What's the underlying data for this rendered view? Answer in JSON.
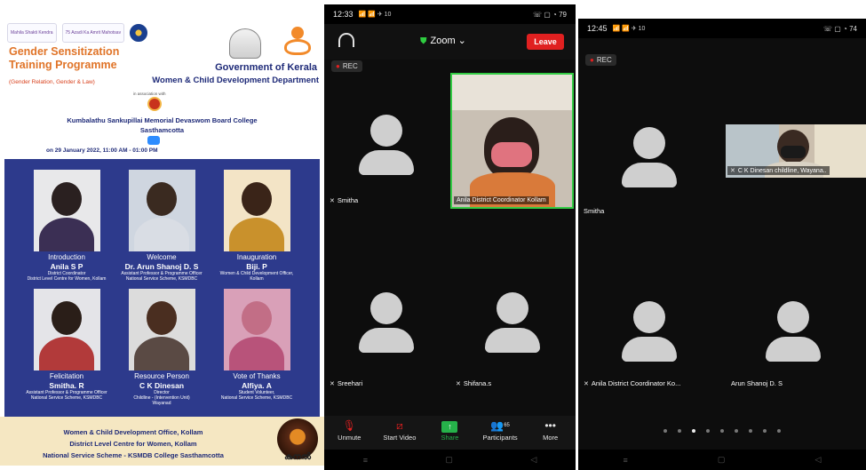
{
  "poster": {
    "logo1": "Mahila Shakti Kendra",
    "logo2": "75 Azadi Ka Amrit Mahotsav",
    "title_line1": "Gender Sensitization",
    "title_line2": "Training Programme",
    "subtitle": "(Gender Relation, Gender & Law)",
    "gov": "Government of Kerala",
    "dept": "Women & Child Development Department",
    "assoc": "in association with",
    "college_line1": "Kumbalathu Sankupillai Memorial Devaswom Board College",
    "college_line2": "Sasthamcotta",
    "date": "on 29 January 2022, 11:00 AM - 01:00 PM",
    "speakers": [
      {
        "role": "Introduction",
        "name": "Anila S P",
        "desc1": "District Coordinator",
        "desc2": "District Level Centre for Women, Kollam",
        "desc3": ""
      },
      {
        "role": "Welcome",
        "name": "Dr. Arun Shanoj D. S",
        "desc1": "Assistant Professor & Programme Officer",
        "desc2": "National Service Scheme, KSMDBC",
        "desc3": ""
      },
      {
        "role": "Inauguration",
        "name": "Biji. P",
        "desc1": "Women & Child Development Officer,",
        "desc2": "Kollam",
        "desc3": ""
      },
      {
        "role": "Felicitation",
        "name": "Smitha. R",
        "desc1": "Assistant Professor & Programme Officer",
        "desc2": "National Service Scheme, KSMDBC",
        "desc3": ""
      },
      {
        "role": "Resource Person",
        "name": "C K Dinesan",
        "desc1": "Director",
        "desc2": "Childline - (Intervention Unit)",
        "desc3": "Wayanad"
      },
      {
        "role": "Vote of Thanks",
        "name": "Alfiya. A",
        "desc1": "Student Volunteer,",
        "desc2": "National Service Scheme, KSMDBC",
        "desc3": ""
      }
    ],
    "footer_line1": "Women & Child Development Office, Kollam",
    "footer_line2": "District Level Centre for Women, Kollam",
    "footer_line3": "National Service Scheme - KSMDB College Sasthamcotta",
    "kanal_text": "കനൽ"
  },
  "phone1": {
    "time": "12:33",
    "status_icons": "📶 📶 ✈ 10",
    "battery": "☏ ▢ ◔ 79",
    "meeting_title": "Zoom ⌄",
    "leave": "Leave",
    "rec": "REC",
    "tiles": {
      "smitha": "Smitha",
      "anila_video": "Anila District Coordinator Kollam",
      "sreehari": "Sreehari",
      "shifana": "Shifana.s"
    },
    "toolbar": {
      "unmute": "Unmute",
      "start_video": "Start Video",
      "share": "Share",
      "participants": "Participants",
      "participants_count": "65",
      "more": "More"
    }
  },
  "phone2": {
    "time": "12:45",
    "status_icons": "📶 📶 ✈ 10",
    "battery": "☏ ▢ ◔ 74",
    "rec": "REC",
    "tiles": {
      "smitha": "Smitha",
      "ck_video": "C K Dinesan childline, Wayana..",
      "anila": "Anila District Coordinator Ko...",
      "arun": "Arun Shanoj D. S"
    }
  },
  "icons": {
    "mic_muted": "🎤",
    "nav_menu": "≡",
    "nav_home": "▢",
    "nav_back": "◁"
  }
}
